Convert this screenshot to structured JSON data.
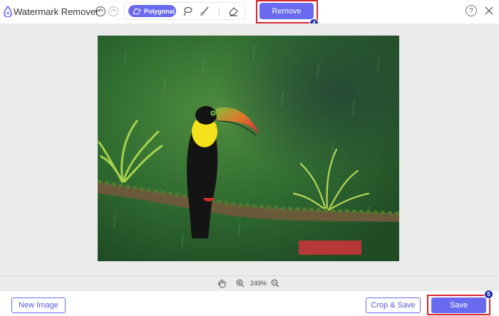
{
  "header": {
    "title": "Watermark Remover",
    "undo_icon": "undo-icon",
    "redo_icon": "redo-icon",
    "tools": {
      "polygonal_label": "Polygonal",
      "items": [
        "polygonal-icon",
        "lasso-icon",
        "brush-icon",
        "eraser-icon"
      ]
    },
    "remove_label": "Remove",
    "remove_step": "4",
    "help_label": "?",
    "close_icon": "close-icon"
  },
  "canvas": {
    "image": "toucan-on-branch",
    "zoom_level": "249%"
  },
  "footer": {
    "new_image_label": "New Image",
    "crop_save_label": "Crop & Save",
    "save_label": "Save",
    "save_step": "5"
  },
  "colors": {
    "accent": "#6a6af0",
    "highlight": "#d6262c",
    "badge": "#1e2fa8"
  }
}
